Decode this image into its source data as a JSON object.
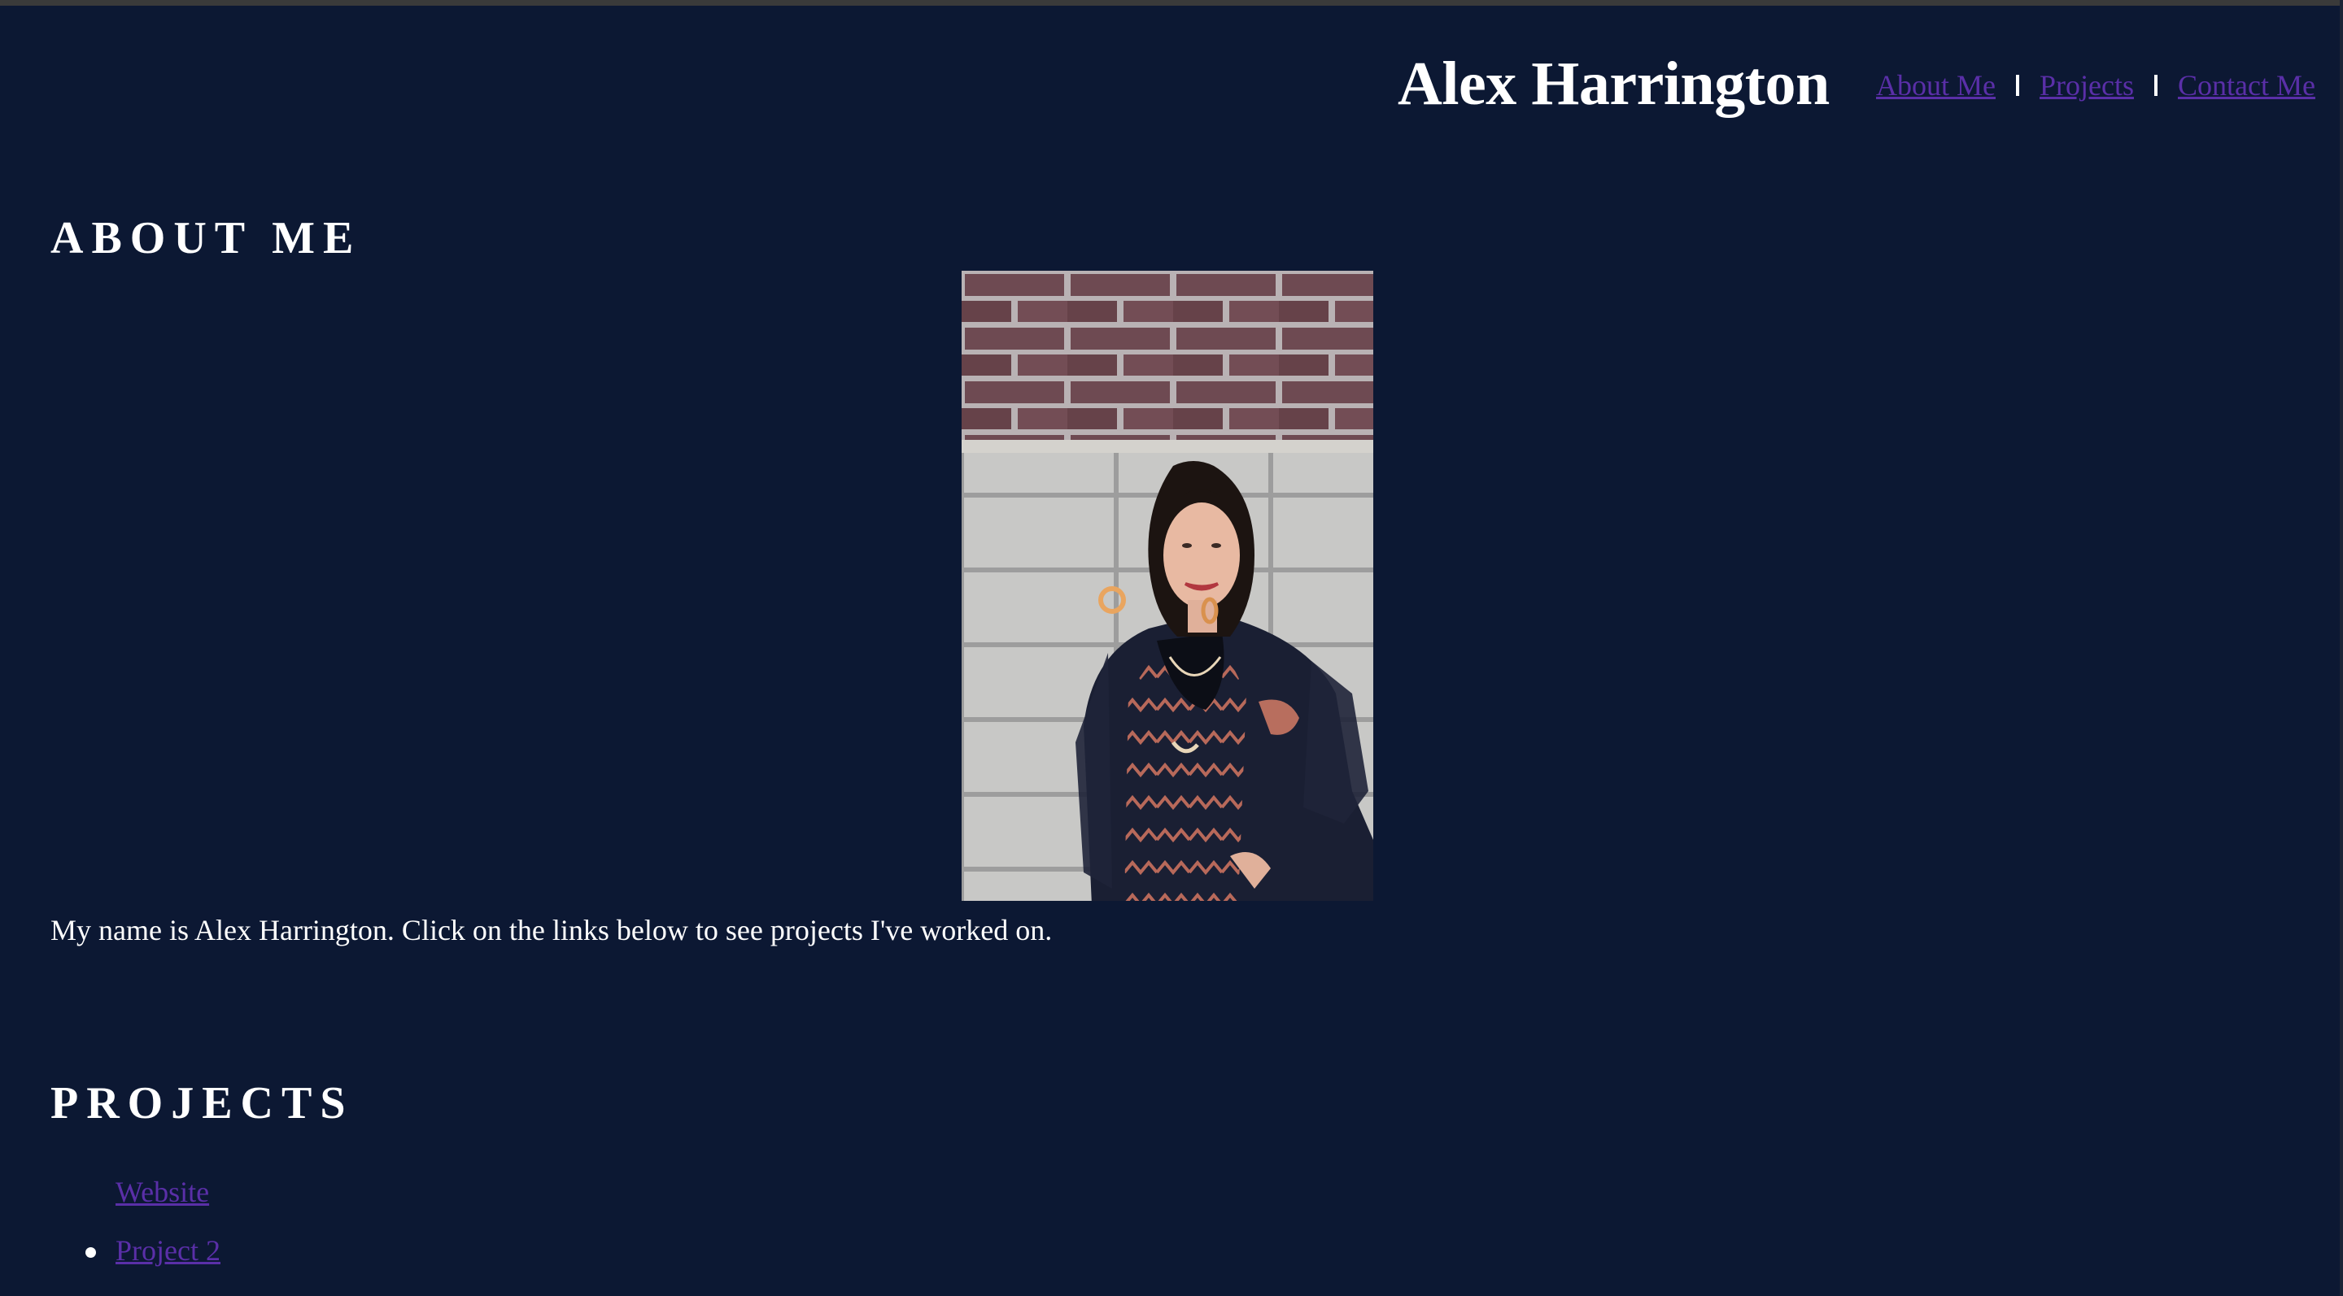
{
  "header": {
    "title": "Alex Harrington",
    "nav": [
      {
        "label": "About Me"
      },
      {
        "label": "Projects"
      },
      {
        "label": "Contact Me"
      }
    ]
  },
  "about": {
    "heading": "ABOUT ME",
    "photo_alt": "Portrait photo",
    "intro": "My name is Alex Harrington. Click on the links below to see projects I've worked on."
  },
  "projects": {
    "heading": "PROJECTS",
    "items": [
      {
        "label": "Website"
      },
      {
        "label": "Project 2"
      }
    ]
  },
  "colors": {
    "background": "#0c1833",
    "link": "#5a2fa8",
    "text": "#ffffff"
  }
}
